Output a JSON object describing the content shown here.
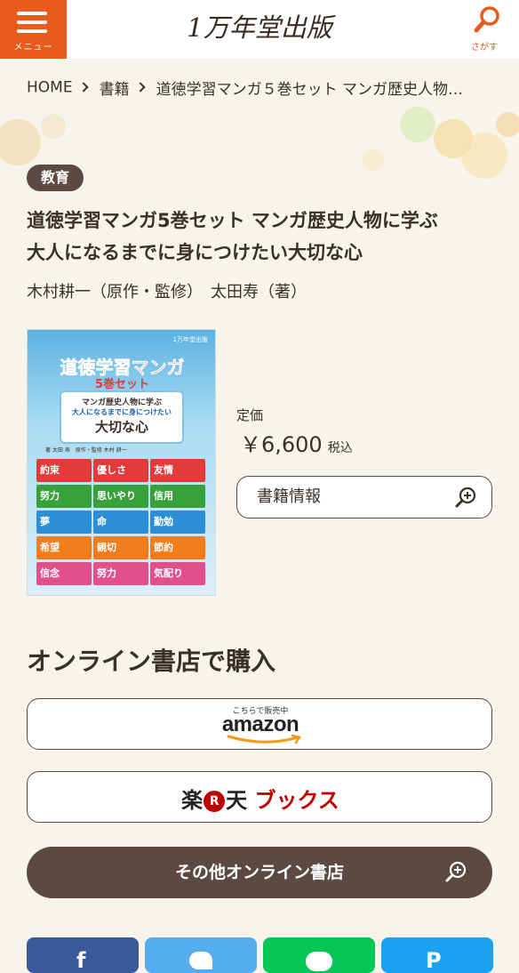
{
  "header": {
    "menu_label": "メニュー",
    "logo_text": "1万年堂出版",
    "search_label": "さがす",
    "accent_color": "#e95a1d"
  },
  "breadcrumb": {
    "home": "HOME",
    "category": "書籍",
    "current": "道徳学習マンガ５巻セット マンガ歴史人物…"
  },
  "book": {
    "tag": "教育",
    "title_line1": "道徳学習マンガ5巻セット マンガ歴史人物に学ぶ",
    "title_line2": "大人になるまでに身につけたい大切な心",
    "authors": "木村耕一（原作・監修）　太田寿（著）",
    "price_label": "定価",
    "price": "￥6,600",
    "tax": "税込",
    "info_button": "書籍情報"
  },
  "cover": {
    "title": "道徳学習マンガ",
    "set": "5巻セット",
    "sub1": "マンガ歴史人物に学ぶ",
    "sub2": "大人になるまでに身につけたい",
    "sub3": "大切な心",
    "publisher": "1万年堂出版",
    "author_line": "著 太田 寿　原作・監修 木村 耕一",
    "virtues": [
      "約束",
      "優しさ",
      "友情",
      "努力",
      "思いやり",
      "信用",
      "夢",
      "命",
      "勤勉",
      "希望",
      "親切",
      "節約",
      "信念",
      "努力",
      "気配り"
    ]
  },
  "purchase": {
    "section_title": "オンライン書店で購入",
    "amazon_small": "こちらで販売中",
    "amazon": "amazon",
    "rakuten_1": "楽",
    "rakuten_r": "R",
    "rakuten_2": "天",
    "rakuten_3": "ブックス",
    "other": "その他オンライン書店"
  },
  "share": {
    "icons": [
      "facebook-icon",
      "twitter-icon",
      "line-icon",
      "pinterest-icon"
    ],
    "colors": [
      "#3b5998",
      "#55acee",
      "#06c755",
      "#1da1f2"
    ]
  }
}
